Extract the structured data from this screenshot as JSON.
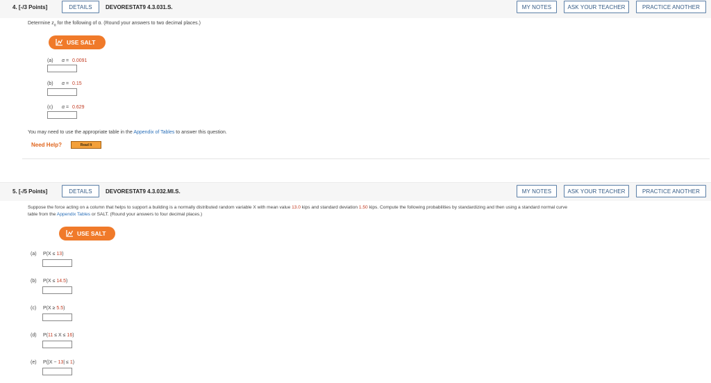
{
  "q4": {
    "number": "4. [-/3 Points]",
    "details": "DETAILS",
    "code": "DEVORESTAT9 4.3.031.S.",
    "my_notes": "MY NOTES",
    "ask_teacher": "ASK YOUR TEACHER",
    "practice": "PRACTICE ANOTHER",
    "instr_a": "Determine z",
    "instr_sub": "α",
    "instr_b": " for the following of α. (Round your answers to two decimal places.)",
    "salt": "USE SALT",
    "parts": [
      {
        "label": "(a)",
        "alpha": "α = ",
        "value": "0.0091"
      },
      {
        "label": "(b)",
        "alpha": "α = ",
        "value": "0.15"
      },
      {
        "label": "(c)",
        "alpha": "α = ",
        "value": "0.629"
      }
    ],
    "table_note_a": "You may need to use the appropriate table in the ",
    "table_note_link": "Appendix of Tables",
    "table_note_b": " to answer this question.",
    "need_help": "Need Help?",
    "read_it": "Read It"
  },
  "q5": {
    "number": "5. [-/5 Points]",
    "details": "DETAILS",
    "code": "DEVORESTAT9 4.3.032.MI.S.",
    "my_notes": "MY NOTES",
    "ask_teacher": "ASK YOUR TEACHER",
    "practice": "PRACTICE ANOTHER",
    "line1_a": "Suppose the force acting on a column that helps to support a building is a normally distributed random variable X with mean value ",
    "mean": "13.0",
    "line1_b": " kips and standard deviation ",
    "sd": "1.50",
    "line1_c": " kips. Compute the following probabilities by standardizing and then using a standard normal curve",
    "line2_a": "table from the ",
    "line2_link": "Appendix Tables",
    "line2_b": " or SALT. (Round your answers to four decimal places.)",
    "salt": "USE SALT",
    "parts": [
      {
        "label": "(a)",
        "pre": "P(X ≤ ",
        "val": "13",
        "post": ")"
      },
      {
        "label": "(b)",
        "pre": "P(X ≤ ",
        "val": "14.5",
        "post": ")"
      },
      {
        "label": "(c)",
        "pre": "P(X ≥ ",
        "val": "5.5",
        "post": ")"
      },
      {
        "label": "(d)",
        "pre": "P(",
        "val": "11",
        "mid": " ≤ X ≤ ",
        "val2": "16",
        "post": ")"
      },
      {
        "label": "(e)",
        "pre": "P(|X − ",
        "val": "13",
        "mid": "| ≤ ",
        "val2": "1",
        "post": ")"
      }
    ]
  },
  "colors": {
    "accent": "#f07a2a",
    "link": "#2a6fb8",
    "value_red": "#c23b22",
    "button_border": "#5b7fa7"
  }
}
